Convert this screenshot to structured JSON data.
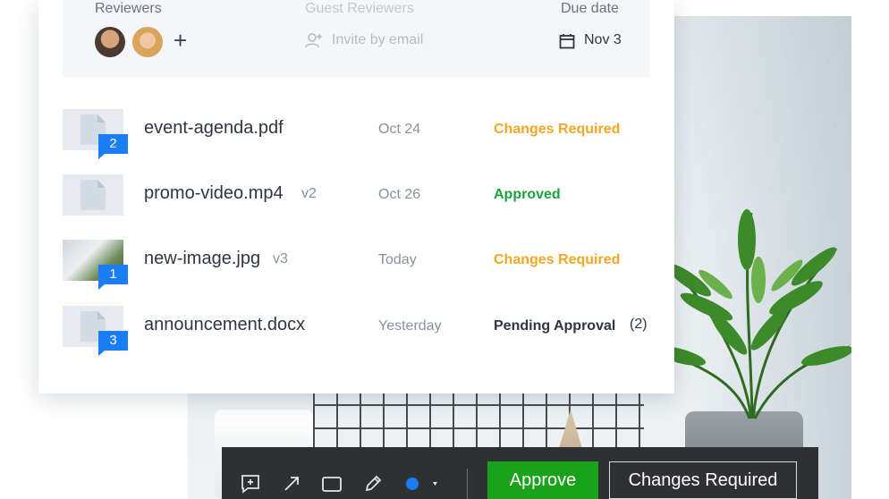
{
  "header": {
    "reviewers_label": "Reviewers",
    "guest_reviewers_label": "Guest Reviewers",
    "due_date_label": "Due date",
    "invite_placeholder": "Invite by email",
    "due_date_value": "Nov 3"
  },
  "files": [
    {
      "name": "event-agenda.pdf",
      "version": "",
      "date": "Oct 24",
      "status": "Changes Required",
      "comments": "2",
      "pending_count": ""
    },
    {
      "name": "promo-video.mp4",
      "version": "v2",
      "date": "Oct 26",
      "status": "Approved",
      "comments": "",
      "pending_count": ""
    },
    {
      "name": "new-image.jpg",
      "version": "v3",
      "date": "Today",
      "status": "Changes Required",
      "comments": "1",
      "pending_count": ""
    },
    {
      "name": "announcement.docx",
      "version": "",
      "date": "Yesterday",
      "status": "Pending Approval",
      "comments": "3",
      "pending_count": "(2)"
    }
  ],
  "toolbar": {
    "approve_label": "Approve",
    "changes_required_label": "Changes Required",
    "color_value": "#1a7df5",
    "tools": [
      "add-comment-icon",
      "arrow-icon",
      "rectangle-icon",
      "pencil-icon",
      "color-picker-icon"
    ]
  },
  "colors": {
    "accent": "#1a7df5",
    "approve": "#1aa31a",
    "changes": "#f5a623",
    "approved_text": "#1aa33a"
  }
}
